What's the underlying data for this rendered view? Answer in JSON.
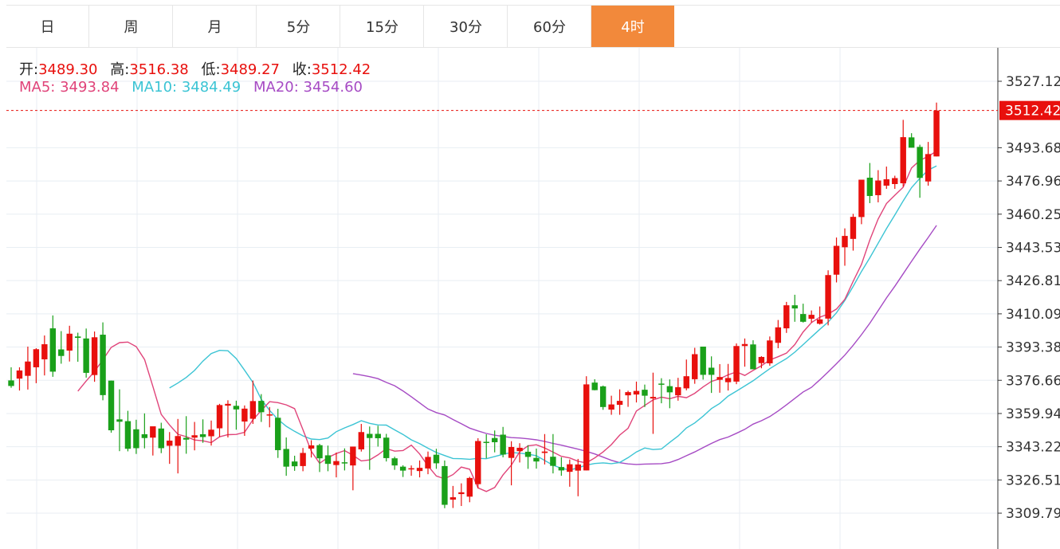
{
  "tabs": [
    "日",
    "周",
    "月",
    "5分",
    "15分",
    "30分",
    "60分",
    "4时"
  ],
  "active_tab": 7,
  "ohlc_labels": {
    "open_label": "开:",
    "open": "3489.30",
    "high_label": "高:",
    "high": "3516.38",
    "low_label": "低:",
    "low": "3489.27",
    "close_label": "收:",
    "close": "3512.42"
  },
  "ma_labels": {
    "ma5_label": "MA5:",
    "ma5": "3493.84",
    "ma10_label": "MA10:",
    "ma10": "3484.49",
    "ma20_label": "MA20:",
    "ma20": "3454.60"
  },
  "current_price": "3512.42",
  "colors": {
    "up": "#e8100d",
    "down": "#1aa01a",
    "ma5": "#e0447a",
    "ma10": "#3cc4d4",
    "ma20": "#a64bc4",
    "accent": "#f2893b"
  },
  "chart_data": {
    "type": "candlestick",
    "y_ticks": [
      "3527.12",
      "3493.68",
      "3476.96",
      "3460.25",
      "3443.53",
      "3426.81",
      "3410.09",
      "3393.38",
      "3376.66",
      "3359.94",
      "3343.22",
      "3326.51",
      "3309.79"
    ],
    "ylim": [
      3309.79,
      3527.12
    ],
    "grid": true,
    "candles": [
      [
        3376.6,
        3383.2,
        3372.9,
        3373.8
      ],
      [
        3377.5,
        3383.2,
        3371.5,
        3381.6
      ],
      [
        3378.9,
        3393.6,
        3372.0,
        3386.1
      ],
      [
        3383.2,
        3392.8,
        3375.2,
        3392.3
      ],
      [
        3387.2,
        3399.2,
        3379.1,
        3394.8
      ],
      [
        3402.8,
        3409.3,
        3378.4,
        3381.0
      ],
      [
        3392.2,
        3401.4,
        3385.0,
        3388.9
      ],
      [
        3391.6,
        3404.1,
        3386.1,
        3400.1
      ],
      [
        3398.7,
        3400.6,
        3386.0,
        3398.0
      ],
      [
        3397.7,
        3402.7,
        3378.0,
        3380.4
      ],
      [
        3379.3,
        3401.2,
        3375.9,
        3398.3
      ],
      [
        3399.6,
        3405.8,
        3366.6,
        3369.2
      ],
      [
        3376.5,
        3376.5,
        3350.3,
        3351.5
      ],
      [
        3357.0,
        3372.1,
        3341.0,
        3355.8
      ],
      [
        3356.1,
        3361.3,
        3340.9,
        3342.2
      ],
      [
        3352.0,
        3356.8,
        3339.6,
        3342.5
      ],
      [
        3349.5,
        3360.0,
        3342.4,
        3347.6
      ],
      [
        3347.8,
        3352.2,
        3338.8,
        3353.5
      ],
      [
        3352.4,
        3355.3,
        3340.0,
        3342.5
      ],
      [
        3343.7,
        3350.6,
        3334.6,
        3346.3
      ],
      [
        3343.7,
        3357.2,
        3329.8,
        3348.6
      ],
      [
        3347.7,
        3358.6,
        3339.7,
        3346.8
      ],
      [
        3347.8,
        3355.7,
        3341.4,
        3349.0
      ],
      [
        3349.5,
        3357.0,
        3345.2,
        3348.1
      ],
      [
        3348.5,
        3356.4,
        3343.8,
        3351.8
      ],
      [
        3352.5,
        3364.8,
        3348.1,
        3364.2
      ],
      [
        3363.9,
        3366.6,
        3347.9,
        3364.8
      ],
      [
        3363.8,
        3366.4,
        3351.8,
        3362.0
      ],
      [
        3355.9,
        3364.0,
        3348.7,
        3362.4
      ],
      [
        3357.3,
        3376.5,
        3354.7,
        3366.2
      ],
      [
        3366.3,
        3369.7,
        3355.7,
        3360.6
      ],
      [
        3359.1,
        3363.2,
        3353.0,
        3359.5
      ],
      [
        3357.8,
        3362.3,
        3337.6,
        3341.5
      ],
      [
        3342.1,
        3347.9,
        3328.6,
        3333.2
      ],
      [
        3335.8,
        3338.7,
        3331.1,
        3333.4
      ],
      [
        3333.5,
        3342.6,
        3330.9,
        3340.1
      ],
      [
        3342.3,
        3346.5,
        3337.8,
        3343.9
      ],
      [
        3344.0,
        3344.7,
        3330.5,
        3337.4
      ],
      [
        3338.9,
        3343.8,
        3330.9,
        3334.6
      ],
      [
        3334.0,
        3340.3,
        3327.8,
        3336.0
      ],
      [
        3335.4,
        3342.4,
        3331.3,
        3335.1
      ],
      [
        3333.8,
        3343.3,
        3321.3,
        3343.3
      ],
      [
        3341.9,
        3354.7,
        3340.8,
        3350.6
      ],
      [
        3349.7,
        3353.4,
        3331.6,
        3347.6
      ],
      [
        3349.7,
        3353.8,
        3343.3,
        3347.5
      ],
      [
        3347.8,
        3349.7,
        3335.8,
        3337.5
      ],
      [
        3337.4,
        3338.2,
        3331.6,
        3333.8
      ],
      [
        3333.2,
        3333.9,
        3328.0,
        3331.2
      ],
      [
        3332.2,
        3333.8,
        3328.6,
        3332.4
      ],
      [
        3331.0,
        3336.3,
        3327.8,
        3332.6
      ],
      [
        3332.3,
        3340.8,
        3329.4,
        3338.1
      ],
      [
        3339.2,
        3342.2,
        3332.1,
        3334.9
      ],
      [
        3333.5,
        3336.3,
        3312.3,
        3314.0
      ],
      [
        3316.6,
        3323.5,
        3312.4,
        3317.8
      ],
      [
        3319.4,
        3324.8,
        3313.4,
        3320.3
      ],
      [
        3318.1,
        3328.1,
        3315.3,
        3327.5
      ],
      [
        3324.4,
        3347.5,
        3322.3,
        3346.1
      ],
      [
        3345.7,
        3349.5,
        3337.4,
        3345.4
      ],
      [
        3347.6,
        3351.4,
        3340.4,
        3345.5
      ],
      [
        3349.3,
        3353.2,
        3337.9,
        3339.3
      ],
      [
        3337.6,
        3346.0,
        3323.8,
        3343.1
      ],
      [
        3341.0,
        3345.0,
        3335.3,
        3342.7
      ],
      [
        3340.7,
        3344.0,
        3332.1,
        3338.1
      ],
      [
        3337.6,
        3342.3,
        3332.2,
        3335.8
      ],
      [
        3340.1,
        3349.6,
        3334.3,
        3340.8
      ],
      [
        3338.2,
        3349.6,
        3329.8,
        3333.6
      ],
      [
        3333.0,
        3337.9,
        3328.6,
        3331.3
      ],
      [
        3330.6,
        3336.8,
        3323.1,
        3334.4
      ],
      [
        3331.2,
        3337.1,
        3318.3,
        3334.3
      ],
      [
        3331.3,
        3378.7,
        3331.3,
        3374.6
      ],
      [
        3375.5,
        3377.2,
        3371.6,
        3371.7
      ],
      [
        3373.6,
        3374.0,
        3361.8,
        3363.2
      ],
      [
        3361.9,
        3368.9,
        3359.3,
        3364.5
      ],
      [
        3364.3,
        3372.1,
        3359.3,
        3366.3
      ],
      [
        3369.1,
        3371.4,
        3363.3,
        3370.7
      ],
      [
        3369.5,
        3376.0,
        3365.5,
        3371.3
      ],
      [
        3371.9,
        3374.5,
        3363.2,
        3368.9
      ],
      [
        3367.5,
        3380.5,
        3349.7,
        3368.3
      ],
      [
        3375.0,
        3377.7,
        3365.1,
        3374.6
      ],
      [
        3373.7,
        3377.1,
        3362.6,
        3370.6
      ],
      [
        3369.1,
        3377.9,
        3366.4,
        3373.2
      ],
      [
        3372.6,
        3387.1,
        3371.6,
        3378.7
      ],
      [
        3377.2,
        3393.0,
        3374.9,
        3389.8
      ],
      [
        3393.6,
        3393.6,
        3377.0,
        3379.4
      ],
      [
        3383.0,
        3388.7,
        3370.3,
        3379.4
      ],
      [
        3376.9,
        3384.8,
        3370.4,
        3378.3
      ],
      [
        3375.7,
        3384.9,
        3371.5,
        3377.8
      ],
      [
        3376.0,
        3395.2,
        3374.7,
        3393.9
      ],
      [
        3393.9,
        3397.7,
        3383.5,
        3394.9
      ],
      [
        3394.7,
        3396.8,
        3382.7,
        3382.2
      ],
      [
        3385.3,
        3388.8,
        3382.7,
        3388.4
      ],
      [
        3385.2,
        3398.7,
        3384.0,
        3396.7
      ],
      [
        3395.5,
        3407.0,
        3392.8,
        3403.3
      ],
      [
        3402.8,
        3416.1,
        3400.5,
        3414.4
      ],
      [
        3414.4,
        3419.7,
        3406.1,
        3412.8
      ],
      [
        3410.0,
        3415.2,
        3405.7,
        3406.1
      ],
      [
        3407.6,
        3411.8,
        3405.7,
        3409.6
      ],
      [
        3405.1,
        3413.8,
        3404.7,
        3407.3
      ],
      [
        3407.7,
        3432.0,
        3404.3,
        3429.6
      ],
      [
        3429.8,
        3448.5,
        3425.9,
        3444.3
      ],
      [
        3443.6,
        3453.1,
        3434.3,
        3449.3
      ],
      [
        3447.8,
        3460.4,
        3441.9,
        3458.9
      ],
      [
        3458.8,
        3474.4,
        3455.2,
        3477.6
      ],
      [
        3478.6,
        3486.0,
        3465.8,
        3469.4
      ],
      [
        3469.8,
        3482.4,
        3466.2,
        3477.2
      ],
      [
        3474.6,
        3484.2,
        3473.0,
        3477.8
      ],
      [
        3475.4,
        3479.6,
        3473.0,
        3478.4
      ],
      [
        3475.8,
        3507.7,
        3474.1,
        3499.0
      ],
      [
        3498.9,
        3501.0,
        3493.8,
        3493.7
      ],
      [
        3494.1,
        3495.2,
        3468.5,
        3478.5
      ],
      [
        3476.7,
        3496.6,
        3474.6,
        3490.5
      ],
      [
        3489.3,
        3516.4,
        3489.3,
        3512.4
      ]
    ],
    "ma5": [
      3371.2,
      3376.3,
      3381.1,
      3387.0,
      3393.2,
      3395.6,
      3395.9,
      3393.6,
      3387.1,
      3373.6,
      3359.5,
      3354.2,
      3349.5,
      3348.3,
      3346.6,
      3346.2,
      3345.3,
      3348.2,
      3349.3,
      3349.4,
      3350.5,
      3356.8,
      3361.4,
      3365.9,
      3365.4,
      3364.3,
      3362.4,
      3351.8,
      3340.9,
      3334.9,
      3337.8,
      3339.8,
      3341.3,
      3338.9,
      3336.1,
      3336.6,
      3339.1,
      3342.3,
      3341.0,
      3341.3,
      3344.0,
      3339.6,
      3333.6,
      3328.5,
      3327.1,
      3329.2,
      3333.0,
      3331.9,
      3322.5,
      3320.7,
      3322.7,
      3329.0,
      3334.0,
      3340.7,
      3343.7,
      3344.2,
      3342.6,
      3340.5,
      3338.4,
      3337.6,
      3335.9,
      3335.1,
      3337.6,
      3340.6,
      3344.3,
      3349.1,
      3352.5,
      3361.2,
      3364.0,
      3366.8,
      3368.2,
      3367.4,
      3368.6,
      3367.9,
      3370.1,
      3373.3,
      3376.1,
      3377.4,
      3379.4,
      3380.9,
      3379.1,
      3381.6,
      3384.0,
      3386.9,
      3388.5,
      3390.3,
      3394.6,
      3401.0,
      3405.7,
      3408.4,
      3410.0,
      3412.5,
      3417.4,
      3426.5,
      3435.0,
      3447.3,
      3457.8,
      3465.6,
      3469.8,
      3473.8,
      3483.5,
      3487.3,
      3489.3,
      3492.0
    ],
    "ma10": [
      3372.8,
      3375.3,
      3378.1,
      3381.6,
      3386.3,
      3390.1,
      3391.7,
      3391.5,
      3387.6,
      3381.7,
      3375.6,
      3367.1,
      3361.5,
      3357.0,
      3353.5,
      3351.0,
      3348.7,
      3347.1,
      3346.8,
      3347.6,
      3350.8,
      3352.7,
      3354.4,
      3356.3,
      3355.0,
      3354.2,
      3354.1,
      3351.7,
      3349.4,
      3346.7,
      3344.8,
      3342.5,
      3340.3,
      3338.8,
      3337.3,
      3337.2,
      3336.9,
      3337.4,
      3337.2,
      3338.3,
      3339.4,
      3340.3,
      3340.0,
      3339.5,
      3338.7,
      3336.3,
      3333.9,
      3332.4,
      3331.5,
      3332.6,
      3334.0,
      3334.8,
      3335.1,
      3334.7,
      3335.3,
      3337.7,
      3340.6,
      3342.6,
      3341.8,
      3342.1,
      3345.4,
      3348.6,
      3352.7,
      3355.2,
      3358.6,
      3362.4,
      3365.0,
      3368.7,
      3371.2,
      3373.8,
      3376.4,
      3379.5,
      3382.5,
      3385.1,
      3387.6,
      3390.8,
      3394.6,
      3398.5,
      3402.3,
      3406.0,
      3410.6,
      3416.8,
      3423.9,
      3431.4,
      3438.3,
      3445.6,
      3453.0,
      3459.9,
      3466.9,
      3473.6,
      3478.3,
      3482.4,
      3484.5
    ],
    "ma20": [
      3380.0,
      3379.3,
      3378.5,
      3377.5,
      3375.6,
      3373.9,
      3371.3,
      3368.4,
      3365.3,
      3362.2,
      3360.4,
      3359.2,
      3356.9,
      3354.8,
      3352.6,
      3351.2,
      3349.9,
      3349.0,
      3348.4,
      3347.8,
      3347.6,
      3347.2,
      3346.7,
      3345.9,
      3344.9,
      3344.0,
      3343.0,
      3342.0,
      3340.9,
      3339.6,
      3338.0,
      3336.4,
      3335.2,
      3334.6,
      3334.3,
      3334.5,
      3334.6,
      3334.7,
      3335.3,
      3336.8,
      3338.7,
      3340.6,
      3342.8,
      3344.9,
      3346.8,
      3348.1,
      3350.0,
      3352.0,
      3354.6,
      3356.3,
      3358.4,
      3361.2,
      3364.3,
      3367.5,
      3370.8,
      3373.1,
      3376.9,
      3380.9,
      3385.0,
      3389.3,
      3394.3,
      3399.6,
      3405.4,
      3411.7,
      3418.1,
      3424.0,
      3430.2,
      3436.5,
      3442.6,
      3448.5,
      3454.6
    ]
  }
}
